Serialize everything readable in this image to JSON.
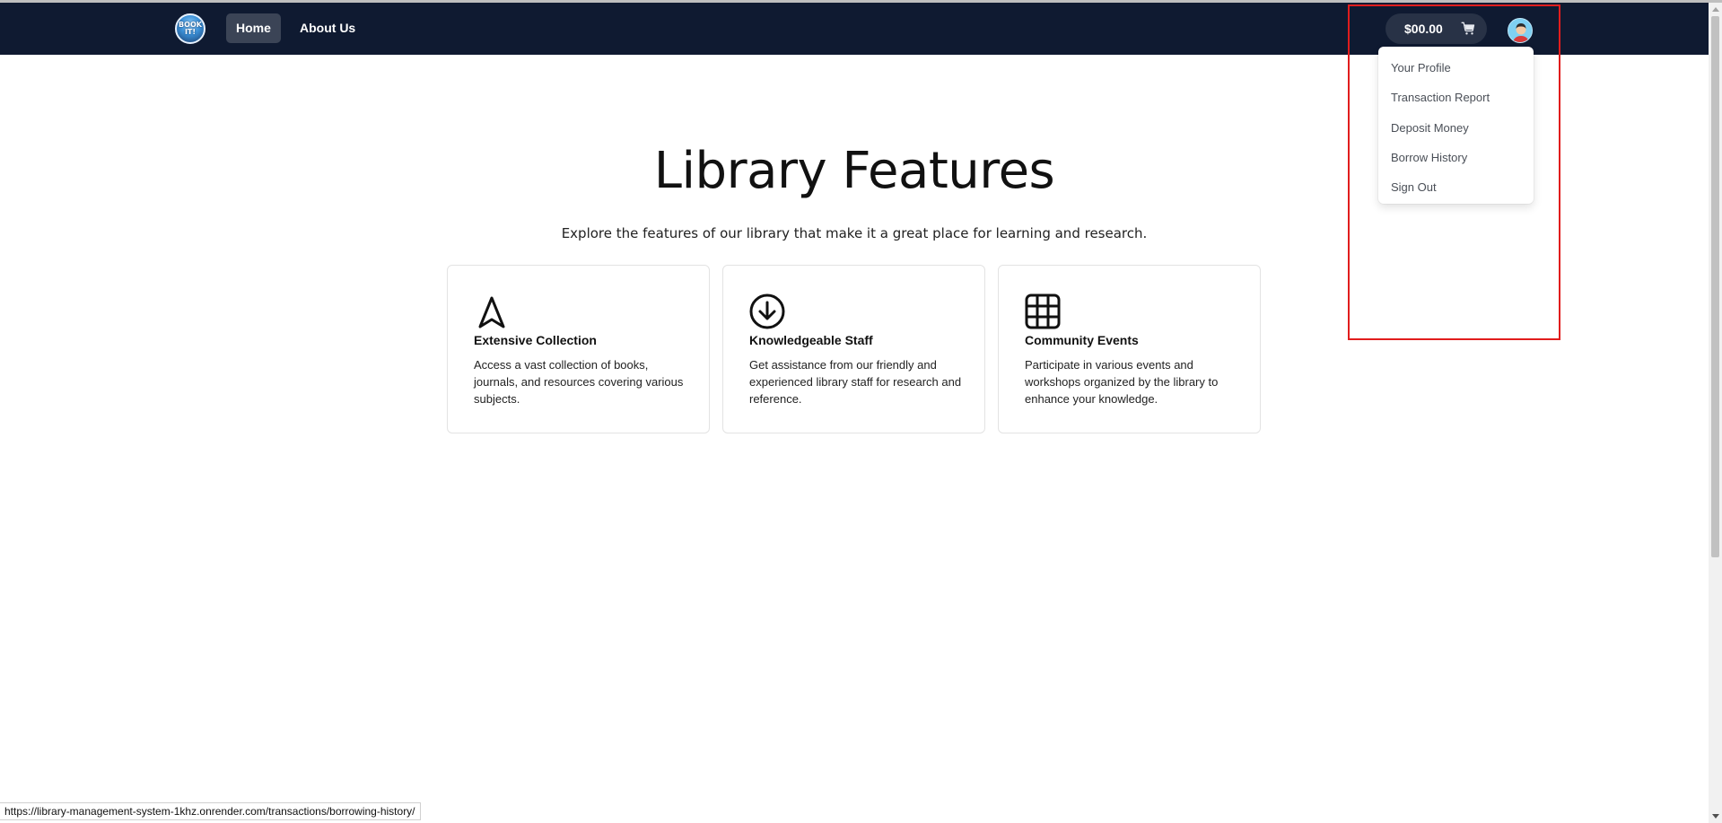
{
  "navbar": {
    "logo_text": "BOOK IT!",
    "links": [
      {
        "label": "Home",
        "active": true
      },
      {
        "label": "About Us",
        "active": false
      }
    ],
    "balance": "$00.00",
    "cart_icon": "shopping-cart-icon",
    "avatar_icon": "user-avatar-icon"
  },
  "dropdown": {
    "items": [
      "Your Profile",
      "Transaction Report",
      "Deposit Money",
      "Borrow History",
      "Sign Out"
    ]
  },
  "hero": {
    "title": "Library Features",
    "subtitle": "Explore the features of our library that make it a great place for learning and research."
  },
  "features": [
    {
      "icon": "navigation-arrow-icon",
      "title": "Extensive Collection",
      "description": "Access a vast collection of books, journals, and resources covering various subjects."
    },
    {
      "icon": "download-circle-icon",
      "title": "Knowledgeable Staff",
      "description": "Get assistance from our friendly and experienced library staff for research and reference."
    },
    {
      "icon": "grid-icon",
      "title": "Community Events",
      "description": "Participate in various events and workshops organized by the library to enhance your knowledge."
    }
  ],
  "status_bar": {
    "url": "https://library-management-system-1khz.onrender.com/transactions/borrowing-history/"
  },
  "colors": {
    "navbar_bg": "#0f1a31",
    "active_link_bg": "#3b4456",
    "highlight_border": "#e11d1d"
  }
}
